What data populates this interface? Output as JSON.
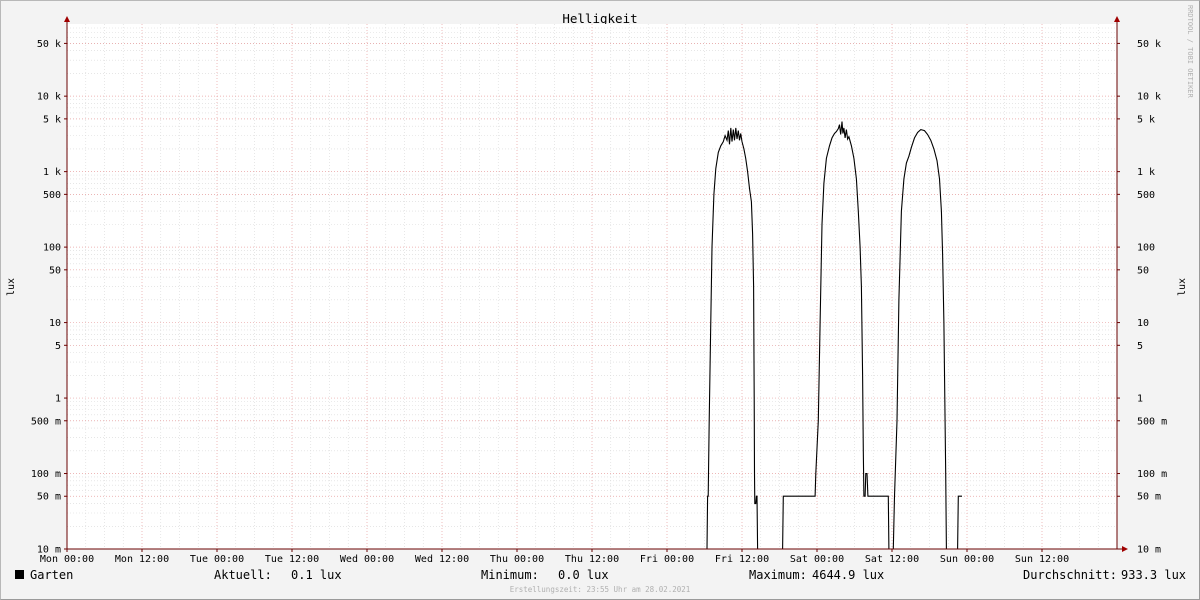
{
  "chart_data": {
    "type": "line",
    "title": "Helligkeit",
    "ylabel": "lux",
    "yscale": "log",
    "ylim": [
      0.01,
      80000
    ],
    "y_ticks": [
      {
        "value": 50000,
        "label": "50 k"
      },
      {
        "value": 10000,
        "label": "10 k"
      },
      {
        "value": 5000,
        "label": "5 k"
      },
      {
        "value": 1000,
        "label": "1 k"
      },
      {
        "value": 500,
        "label": "500"
      },
      {
        "value": 100,
        "label": "100"
      },
      {
        "value": 50,
        "label": "50"
      },
      {
        "value": 10,
        "label": "10"
      },
      {
        "value": 5,
        "label": "5"
      },
      {
        "value": 1,
        "label": "1"
      },
      {
        "value": 0.5,
        "label": "500 m"
      },
      {
        "value": 0.1,
        "label": "100 m"
      },
      {
        "value": 0.05,
        "label": "50 m"
      },
      {
        "value": 0.01,
        "label": "10 m"
      }
    ],
    "x_unit": "hours since Mon 00:00",
    "xlim": [
      0,
      168
    ],
    "x_ticks": [
      {
        "value": 0,
        "label": "Mon 00:00"
      },
      {
        "value": 12,
        "label": "Mon 12:00"
      },
      {
        "value": 24,
        "label": "Tue 00:00"
      },
      {
        "value": 36,
        "label": "Tue 12:00"
      },
      {
        "value": 48,
        "label": "Wed 00:00"
      },
      {
        "value": 60,
        "label": "Wed 12:00"
      },
      {
        "value": 72,
        "label": "Thu 00:00"
      },
      {
        "value": 84,
        "label": "Thu 12:00"
      },
      {
        "value": 96,
        "label": "Fri 00:00"
      },
      {
        "value": 108,
        "label": "Fri 12:00"
      },
      {
        "value": 120,
        "label": "Sat 00:00"
      },
      {
        "value": 132,
        "label": "Sat 12:00"
      },
      {
        "value": 144,
        "label": "Sun 00:00"
      },
      {
        "value": 156,
        "label": "Sun 12:00"
      }
    ],
    "grid": true,
    "series": [
      {
        "name": "Garten",
        "color": "#000000",
        "points": [
          [
            102.4,
            0.01
          ],
          [
            102.5,
            0.05
          ],
          [
            102.6,
            0.05
          ],
          [
            102.75,
            0.5
          ],
          [
            102.95,
            5
          ],
          [
            103.2,
            100
          ],
          [
            103.5,
            500
          ],
          [
            103.8,
            1100
          ],
          [
            104.2,
            1800
          ],
          [
            104.6,
            2200
          ],
          [
            105.0,
            2500
          ],
          [
            105.3,
            3000
          ],
          [
            105.6,
            2600
          ],
          [
            105.8,
            3500
          ],
          [
            106.0,
            2300
          ],
          [
            106.2,
            3800
          ],
          [
            106.4,
            2500
          ],
          [
            106.6,
            3600
          ],
          [
            106.8,
            2600
          ],
          [
            107.0,
            3800
          ],
          [
            107.2,
            2700
          ],
          [
            107.4,
            3500
          ],
          [
            107.6,
            2600
          ],
          [
            107.8,
            3200
          ],
          [
            108.0,
            2500
          ],
          [
            108.3,
            2000
          ],
          [
            108.6,
            1500
          ],
          [
            108.9,
            1000
          ],
          [
            109.2,
            600
          ],
          [
            109.5,
            400
          ],
          [
            109.7,
            150
          ],
          [
            109.85,
            30
          ],
          [
            109.95,
            1
          ],
          [
            110.0,
            0.1
          ],
          [
            110.05,
            0.04
          ],
          [
            110.2,
            0.04
          ],
          [
            110.3,
            0.05
          ],
          [
            110.4,
            0.05
          ],
          [
            110.5,
            0.01
          ],
          [
            114.5,
            0.01
          ],
          [
            114.6,
            0.05
          ],
          [
            119.7,
            0.05
          ],
          [
            119.8,
            0.1
          ],
          [
            120.2,
            0.5
          ],
          [
            120.5,
            10
          ],
          [
            120.8,
            200
          ],
          [
            121.1,
            700
          ],
          [
            121.5,
            1500
          ],
          [
            122.0,
            2200
          ],
          [
            122.4,
            2800
          ],
          [
            122.8,
            3200
          ],
          [
            123.1,
            3400
          ],
          [
            123.4,
            3700
          ],
          [
            123.6,
            4200
          ],
          [
            123.8,
            3100
          ],
          [
            124.0,
            4600
          ],
          [
            124.15,
            3200
          ],
          [
            124.3,
            3800
          ],
          [
            124.5,
            2800
          ],
          [
            124.7,
            3600
          ],
          [
            124.9,
            2700
          ],
          [
            125.1,
            2900
          ],
          [
            125.5,
            2200
          ],
          [
            125.9,
            1500
          ],
          [
            126.3,
            800
          ],
          [
            126.6,
            300
          ],
          [
            126.9,
            100
          ],
          [
            127.1,
            30
          ],
          [
            127.3,
            2
          ],
          [
            127.4,
            0.2
          ],
          [
            127.5,
            0.05
          ],
          [
            127.7,
            0.05
          ],
          [
            127.8,
            0.1
          ],
          [
            128.0,
            0.1
          ],
          [
            128.15,
            0.05
          ],
          [
            130.0,
            0.05
          ],
          [
            130.2,
            0.05
          ],
          [
            130.6,
            0.05
          ],
          [
            131.4,
            0.05
          ],
          [
            131.5,
            0.01
          ],
          [
            132.2,
            0.01
          ],
          [
            132.4,
            0.05
          ],
          [
            132.8,
            0.5
          ],
          [
            133.1,
            20
          ],
          [
            133.5,
            300
          ],
          [
            133.9,
            800
          ],
          [
            134.3,
            1300
          ],
          [
            134.7,
            1600
          ],
          [
            135.1,
            2100
          ],
          [
            135.6,
            2800
          ],
          [
            136.1,
            3300
          ],
          [
            136.6,
            3600
          ],
          [
            137.2,
            3500
          ],
          [
            137.7,
            3100
          ],
          [
            138.2,
            2600
          ],
          [
            138.7,
            2000
          ],
          [
            139.2,
            1400
          ],
          [
            139.6,
            800
          ],
          [
            139.9,
            300
          ],
          [
            140.1,
            80
          ],
          [
            140.3,
            10
          ],
          [
            140.45,
            1
          ],
          [
            140.6,
            0.1
          ],
          [
            140.7,
            0.01
          ],
          [
            142.5,
            0.01
          ],
          [
            142.6,
            0.05
          ],
          [
            143.2,
            0.05
          ]
        ]
      }
    ]
  },
  "watermark": "RRDTOOL / TOBI OETIKER",
  "legend": {
    "series_name": "Garten",
    "swatch_color": "#000000",
    "current_label": "Aktuell:",
    "current_value": "0.1 lux",
    "min_label": "Minimum:",
    "min_value": "0.0 lux",
    "max_label": "Maximum:",
    "max_value": "4644.9 lux",
    "avg_label": "Durchschnitt:",
    "avg_value": "933.3 lux"
  },
  "footer": "Erstellungszeit: 23:55 Uhr am 28.02.2021",
  "colors": {
    "background": "#f3f3f3",
    "canvas": "#ffffff",
    "major_grid": "#e8a0a0",
    "minor_grid": "#d8d8d8",
    "axis": "#6a0000",
    "line": "#000000"
  }
}
